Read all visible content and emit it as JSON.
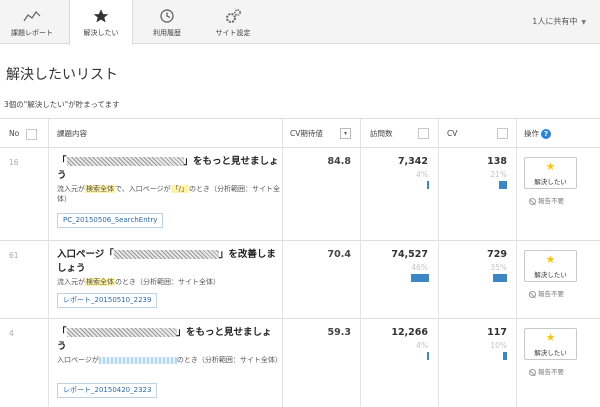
{
  "nav": {
    "tabs": [
      {
        "label": "課題レポート",
        "icon": "chart-line-icon"
      },
      {
        "label": "解決したい",
        "icon": "star-icon"
      },
      {
        "label": "利用履歴",
        "icon": "clock-icon"
      },
      {
        "label": "サイト設定",
        "icon": "gears-icon"
      }
    ],
    "share_label": "1人に共有中",
    "share_caret": "▼"
  },
  "page": {
    "title": "解決したいリスト",
    "count_line": "3個の\"解決したい\"が貯まってます"
  },
  "table": {
    "headers": {
      "no": "No",
      "content": "課題内容",
      "cv_expected": "CV期待値",
      "visits": "訪問数",
      "cv": "CV",
      "action": "操作",
      "help": "?",
      "sort_caret": "▾"
    },
    "want_label": "解決したい",
    "star_glyph": "★",
    "unneeded_label": "報告不要",
    "rows": [
      {
        "no": "16",
        "title_open": "「",
        "title_close": "」をもっと見せましょう",
        "desc_a": "流入元が",
        "desc_hl": "検索全体",
        "desc_b": "で、入口ページが",
        "desc_hl2": "「/」",
        "desc_c": "のとき（分析範囲：サイト全体）",
        "tag": "PC_20150506_SearchEntry",
        "cv_expected": "84.8",
        "visits": "7,342",
        "visits_pct": "4%",
        "visits_share": 0.04,
        "cv": "138",
        "cv_pct": "21%",
        "cv_share": 0.21
      },
      {
        "no": "61",
        "title_open": "入口ページ「",
        "title_close": "」を改善しましょう",
        "desc_a": "流入元が",
        "desc_hl": "検索全体",
        "desc_b": "のとき（分析範囲：サイト全体）",
        "tag": "レポート_20150510_2239",
        "cv_expected": "70.4",
        "visits": "74,527",
        "visits_pct": "46%",
        "visits_share": 0.46,
        "cv": "729",
        "cv_pct": "35%",
        "cv_share": 0.35
      },
      {
        "no": "4",
        "title_open": "「",
        "title_close": "」をもっと見せましょう",
        "desc_a": "入口ページが",
        "desc_b": "のとき（分析範囲：サイト全体）",
        "tag": "レポート_20150420_2323",
        "cv_expected": "59.3",
        "visits": "12,266",
        "visits_pct": "4%",
        "visits_share": 0.04,
        "cv": "117",
        "cv_pct": "10%",
        "cv_share": 0.1
      }
    ]
  }
}
